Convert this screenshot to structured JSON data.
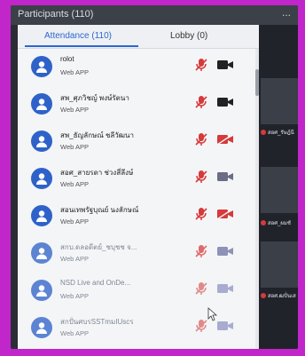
{
  "window": {
    "title": "Participants (110)",
    "menu": "..."
  },
  "tabs": [
    {
      "label": "Attendance (110)",
      "active": true
    },
    {
      "label": "Lobby (0)",
      "active": false
    }
  ],
  "participants": [
    {
      "name": "rolot",
      "sub": "Web APP",
      "mic": "muted",
      "camera": "off"
    },
    {
      "name": "สพ_ศุภวิชญ์ พงษ์รัตนา",
      "sub": "Web APP",
      "mic": "muted",
      "camera": "off"
    },
    {
      "name": "สพ_ธัญลักษณ์ ชลีวัฒนา",
      "sub": "Web APP",
      "mic": "muted",
      "camera": "muted"
    },
    {
      "name": "สอศ_สายรดา ช่วงสี่ลึงษ์",
      "sub": "Web APP",
      "mic": "muted",
      "camera": "off"
    },
    {
      "name": "สอนเทพรัฐบุณย์ นงลักษณ์",
      "sub": "Web APP",
      "mic": "muted",
      "camera": "muted"
    },
    {
      "name": "สกบ.ดลอดีตย์_ชบุชช จ...",
      "sub": "Web APP",
      "mic": "muted",
      "camera": "off"
    },
    {
      "name": "NSD Live and OnDe...",
      "sub": "Web APP",
      "mic": "muted",
      "camera": "off"
    },
    {
      "name": "สกปั่นศบรSSTmมIUscร",
      "sub": "Web APP",
      "mic": "muted",
      "camera": "off"
    }
  ],
  "video_tiles": [
    {
      "label": "สอศ_รัษฎ์นี"
    },
    {
      "label": "สอศ_ผมชั"
    },
    {
      "label": "สอศ.ฒปั่นเส"
    }
  ],
  "colors": {
    "accent": "#2d67d0",
    "muted_icon": "#d63a3a",
    "off_icon": "#222222",
    "frame": "#c026c9"
  }
}
